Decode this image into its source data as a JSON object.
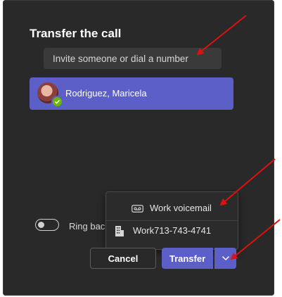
{
  "dialog": {
    "title": "Transfer the call",
    "search_placeholder": "Invite someone or dial a number",
    "selected_person": "Rodriguez, Maricela",
    "ring_back_label": "Ring bac"
  },
  "transfer_menu": {
    "items": [
      {
        "label": "Work voicemail",
        "icon": "voicemail-icon"
      },
      {
        "label": "Work713-743-4741",
        "icon": "building-icon"
      }
    ]
  },
  "buttons": {
    "cancel": "Cancel",
    "transfer": "Transfer"
  },
  "colors": {
    "panel": "#292929",
    "accent": "#5b5fc7",
    "input": "#3a3a3a",
    "presence": "#6bb700",
    "annotation_arrow": "#e01010"
  }
}
